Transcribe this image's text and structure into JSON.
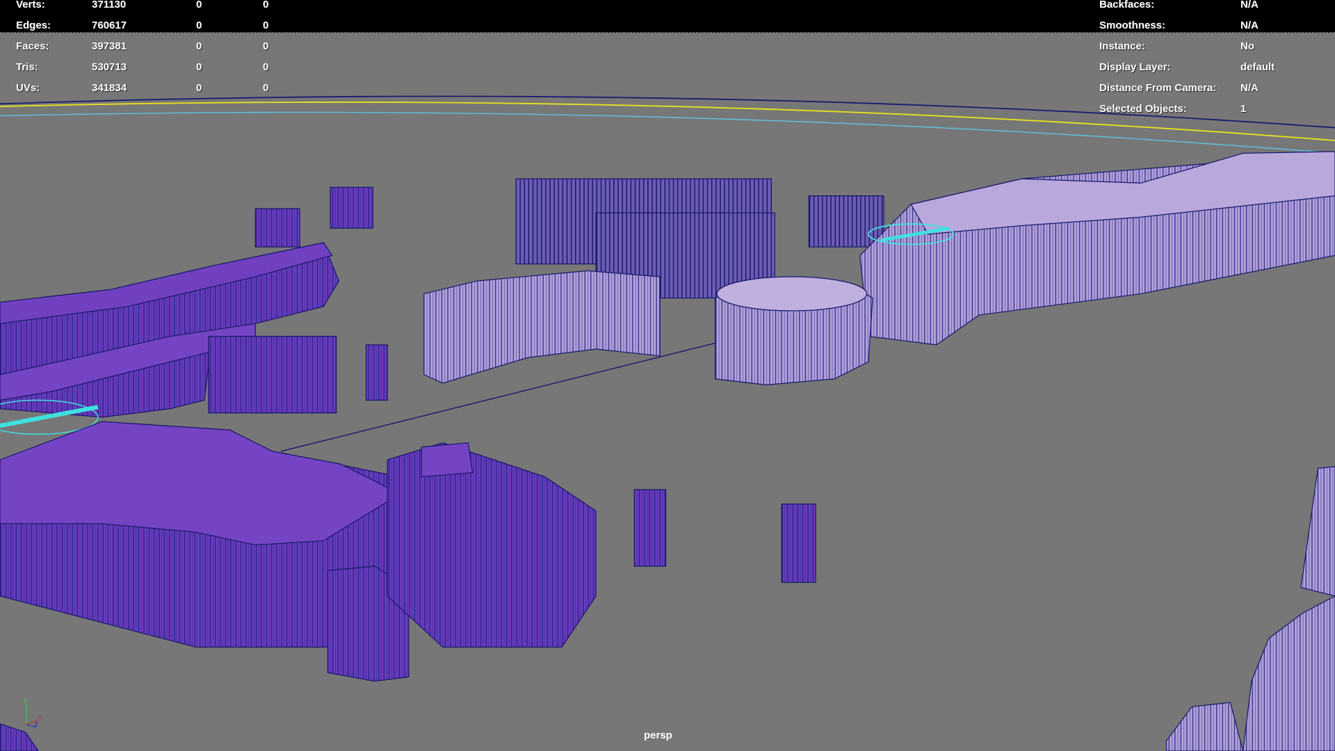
{
  "hud_left": {
    "rows": [
      {
        "label": "Verts:",
        "value": "371130",
        "c2": "0",
        "c3": "0"
      },
      {
        "label": "Edges:",
        "value": "760617",
        "c2": "0",
        "c3": "0"
      },
      {
        "label": "Faces:",
        "value": "397381",
        "c2": "0",
        "c3": "0"
      },
      {
        "label": "Tris:",
        "value": "530713",
        "c2": "0",
        "c3": "0"
      },
      {
        "label": "UVs:",
        "value": "341834",
        "c2": "0",
        "c3": "0"
      }
    ]
  },
  "hud_right": {
    "rows": [
      {
        "label": "Backfaces:",
        "value": "N/A"
      },
      {
        "label": "Smoothness:",
        "value": "N/A"
      },
      {
        "label": "Instance:",
        "value": "No"
      },
      {
        "label": "Display Layer:",
        "value": "default"
      },
      {
        "label": "Distance From Camera:",
        "value": "N/A"
      },
      {
        "label": "Selected Objects:",
        "value": "1"
      }
    ]
  },
  "viewport": {
    "camera_label": "persp",
    "axis": {
      "x": "x",
      "y": "y",
      "z": "z"
    },
    "colors": {
      "background": "#777777",
      "mesh_top": "#7444c4",
      "mesh_side": "#6a3cc0",
      "mesh_light": "#b4a4dc",
      "wire": "#1a1a6e",
      "selection": "#40e0e0"
    }
  }
}
